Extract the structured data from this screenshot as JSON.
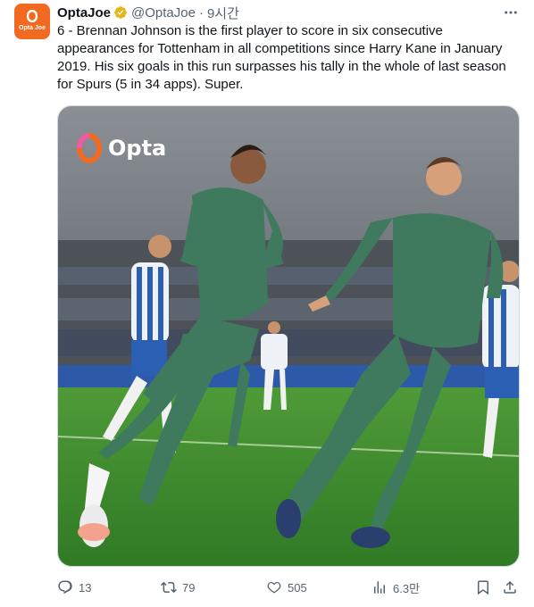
{
  "tweet": {
    "author": {
      "display_name": "OptaJoe",
      "handle": "@OptaJoe",
      "avatar_label": "Opta Joe",
      "verified": true,
      "verified_color": "#e2b719"
    },
    "separator": "·",
    "time": "9시간",
    "text": "6 - Brennan Johnson is the first player to score in six consecutive appearances for Tottenham in all competitions since Harry Kane in January 2019. His six goals in this run surpasses his tally in the whole of last season for Spurs (5 in 34 apps). Super.",
    "media": {
      "watermark": "Opta",
      "description_icon": "photo-icon"
    },
    "actions": {
      "replies": "13",
      "reposts": "79",
      "likes": "505",
      "views": "6.3만"
    }
  },
  "colors": {
    "brand": "#f26a21",
    "text": "#0f1419",
    "muted": "#536471",
    "pitch": "#3f8a2e",
    "kit": "#3f7a5e"
  }
}
